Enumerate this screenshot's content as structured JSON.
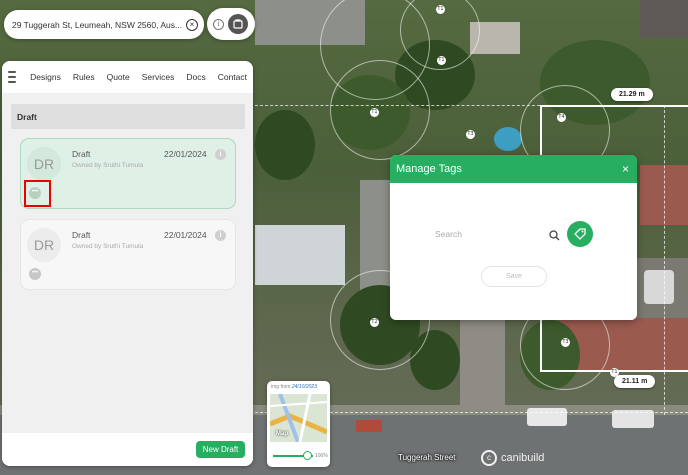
{
  "address": {
    "text": "29 Tuggerah St, Leumeah, NSW 2560, Aus...",
    "clear_icon": "close-circle-icon",
    "info_icon": "info-icon",
    "layers_icon": "map-layers-icon"
  },
  "nav": {
    "items": [
      "Designs",
      "Rules",
      "Quote",
      "Services",
      "Docs",
      "Contact"
    ]
  },
  "section": {
    "title": "Draft"
  },
  "designs": [
    {
      "initials": "DR",
      "name": "Draft",
      "owner": "Owned by Sruthi Tumula",
      "date": "22/01/2024",
      "info": "i",
      "tag": "•••"
    },
    {
      "initials": "DR",
      "name": "Draft",
      "owner": "Owned by Sruthi Tumula",
      "date": "22/01/2024",
      "info": "i",
      "tag": "•••"
    }
  ],
  "footer": {
    "new_draft": "New Draft"
  },
  "map": {
    "measurements": [
      "21.29 m",
      "21.11 m"
    ],
    "tree_labels": [
      "T1",
      "T1",
      "T3",
      "T4",
      "T1",
      "T2",
      "T3",
      "T1"
    ],
    "street": "Tuggerah Street",
    "brand": "canibuild"
  },
  "inset": {
    "caption_prefix": "img from",
    "caption_date": "24/10/2023",
    "label": "Map",
    "opacity_pct": "100%"
  },
  "modal": {
    "title": "Manage Tags",
    "close": "×",
    "search_placeholder": "Search",
    "save_label": "Save"
  },
  "colors": {
    "accent": "#27ae60",
    "highlight": "#e00000"
  }
}
